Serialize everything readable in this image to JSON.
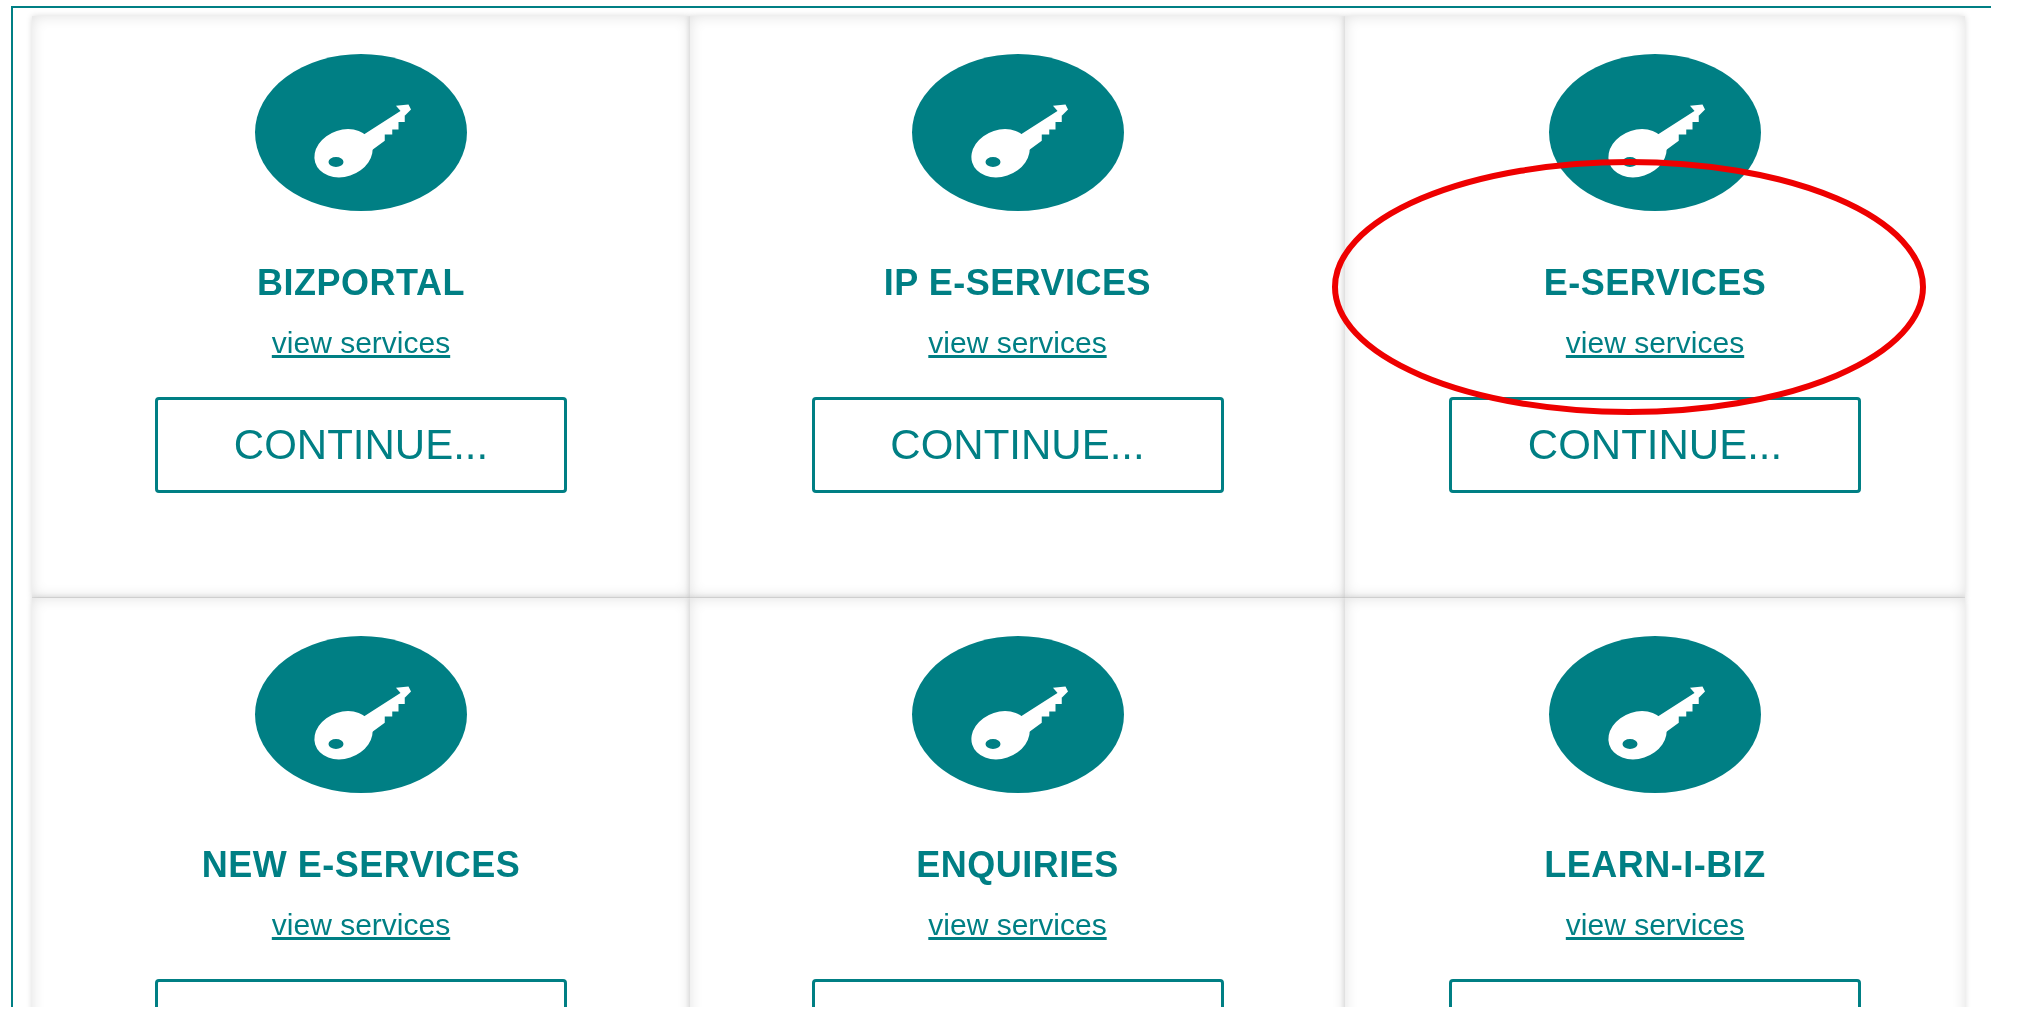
{
  "cards": [
    {
      "title": "BIZPORTAL",
      "link": "view services",
      "button": "CONTINUE...",
      "circled": false
    },
    {
      "title": "IP E-SERVICES",
      "link": "view services",
      "button": "CONTINUE...",
      "circled": false
    },
    {
      "title": "E-SERVICES",
      "link": "view services",
      "button": "CONTINUE...",
      "circled": true
    },
    {
      "title": "NEW E-SERVICES",
      "link": "view services",
      "circled": false
    },
    {
      "title": "ENQUIRIES",
      "link": "view services",
      "circled": false
    },
    {
      "title": "LEARN-I-BIZ",
      "link": "view services",
      "circled": false
    }
  ]
}
